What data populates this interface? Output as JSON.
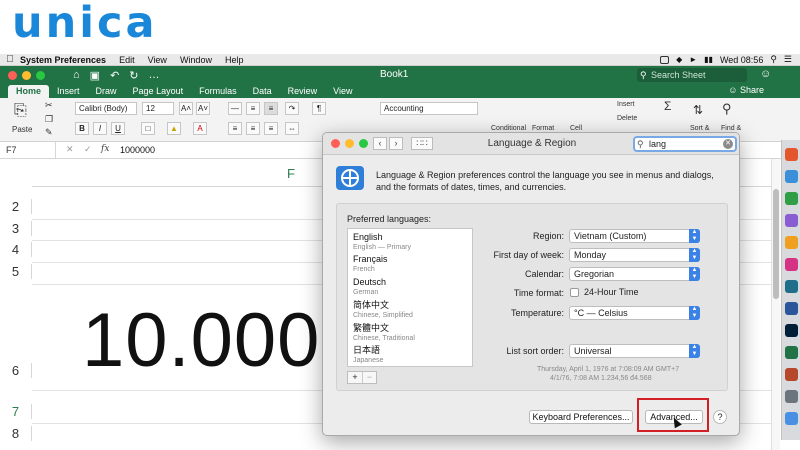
{
  "brand": {
    "logo": "unica",
    "color": "#1b87d8"
  },
  "menubar": {
    "app": "System Preferences",
    "items": [
      "Edit",
      "View",
      "Window",
      "Help"
    ],
    "clock": "Wed 08:56"
  },
  "excel": {
    "book_title": "Book1",
    "search_placeholder": "Search Sheet",
    "tabs": [
      "Home",
      "Insert",
      "Draw",
      "Page Layout",
      "Formulas",
      "Data",
      "Review",
      "View"
    ],
    "active_tab": "Home",
    "share_label": "Share",
    "accent": "#217346",
    "ribbon": {
      "paste": "Paste",
      "font_name": "Calibri (Body)",
      "font_size": "12",
      "number_format": "Accounting",
      "insert": "Insert",
      "delete": "Delete",
      "conditional": "Conditional",
      "format": "Format",
      "cell": "Cell",
      "sort": "Sort &",
      "find": "Find &"
    },
    "formula_bar": {
      "cell_ref": "F7",
      "fx": "fx",
      "value": "1000000"
    },
    "column_label": "F",
    "rows": [
      "2",
      "3",
      "4",
      "5",
      "6",
      "7",
      "8"
    ],
    "cell_display": "10.000"
  },
  "dialog": {
    "title": "Language & Region",
    "search_value": "lang",
    "description": "Language & Region preferences control the language you see in menus and dialogs, and the formats of dates, times, and currencies.",
    "preferred_label": "Preferred languages:",
    "languages": [
      {
        "name": "English",
        "sub": "English — Primary"
      },
      {
        "name": "Français",
        "sub": "French"
      },
      {
        "name": "Deutsch",
        "sub": "German"
      },
      {
        "name": "简体中文",
        "sub": "Chinese, Simplified"
      },
      {
        "name": "繁體中文",
        "sub": "Chinese, Traditional"
      },
      {
        "name": "日本語",
        "sub": "Japanese"
      }
    ],
    "add": "+",
    "remove": "−",
    "fields": {
      "region_label": "Region:",
      "region_value": "Vietnam (Custom)",
      "first_day_label": "First day of week:",
      "first_day_value": "Monday",
      "calendar_label": "Calendar:",
      "calendar_value": "Gregorian",
      "time_format_label": "Time format:",
      "time_format_option": "24-Hour Time",
      "temperature_label": "Temperature:",
      "temperature_value": "°C — Celsius",
      "sort_order_label": "List sort order:",
      "sort_order_value": "Universal"
    },
    "sample_line1": "Thursday, April 1, 1976 at 7:08:09 AM GMT+7",
    "sample_line2": "4/1/76, 7:08 AM    1.234,56    đ4.568",
    "keyboard_button": "Keyboard Preferences...",
    "advanced_button": "Advanced...",
    "help": "?"
  }
}
